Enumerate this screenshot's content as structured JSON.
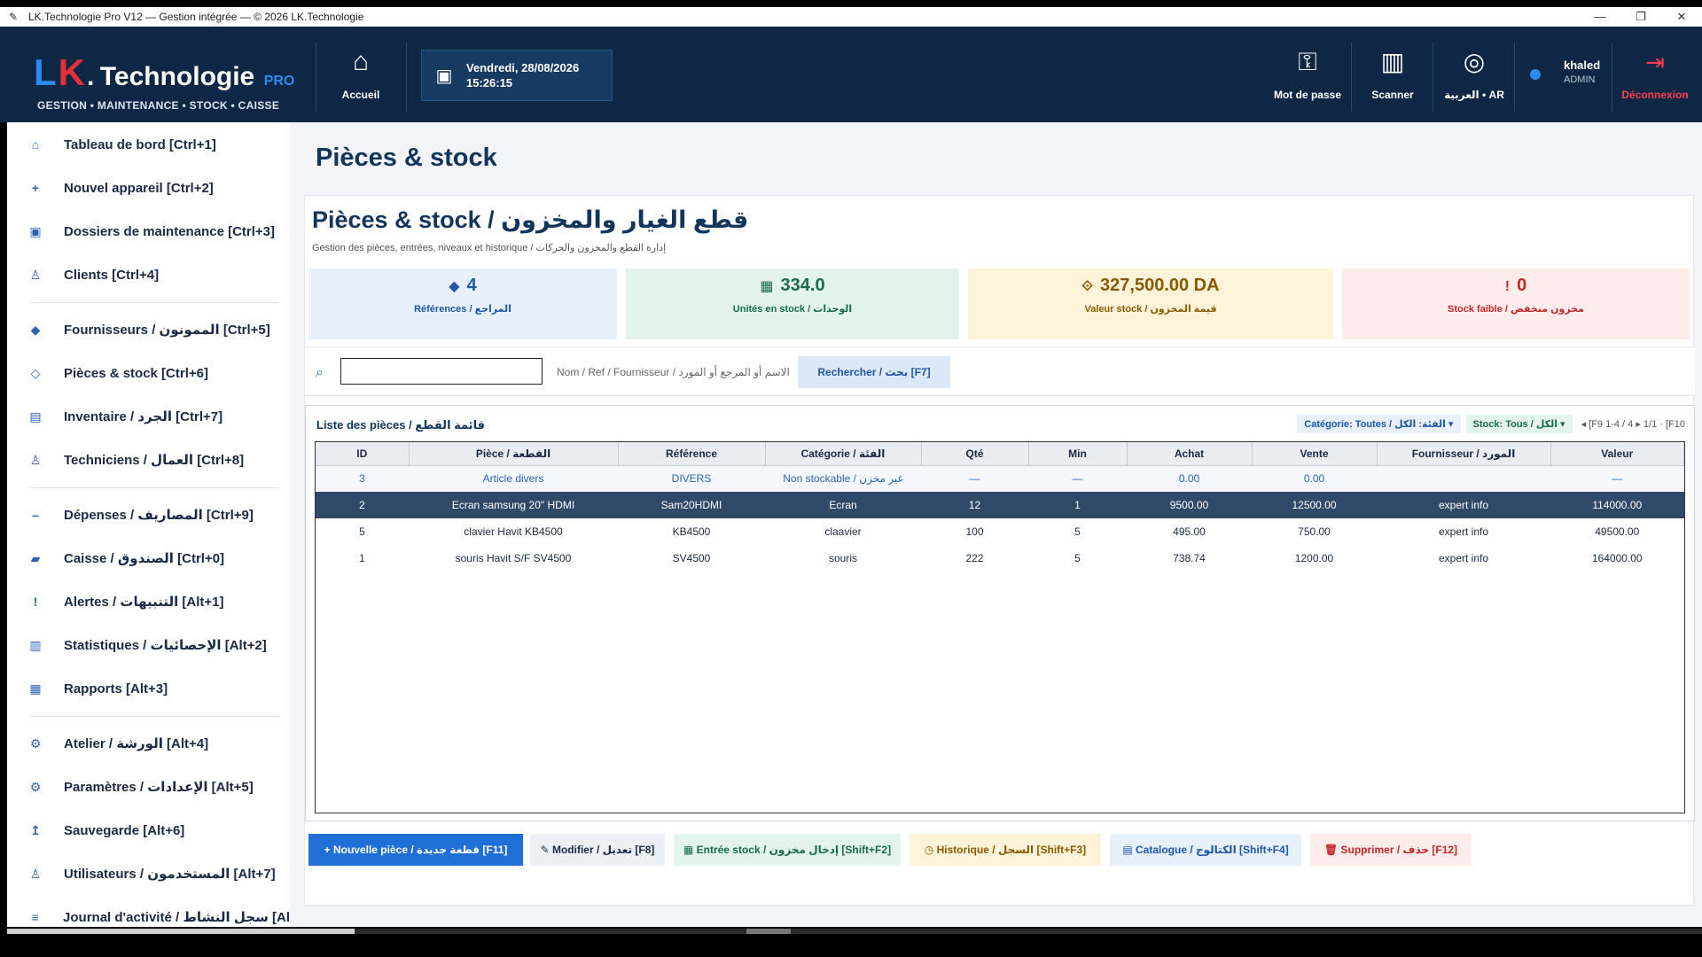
{
  "window": {
    "title": "LK.Technologie Pro V12 — Gestion intégrée — © 2026 LK.Technologie",
    "controls": [
      "—",
      "❐",
      "✕"
    ]
  },
  "header": {
    "logo_l": "L",
    "logo_k": "K",
    "logo_dot": ".",
    "logo_name": "Technologie",
    "logo_pro": "PRO",
    "logo_sub": "GESTION • MAINTENANCE • STOCK • CAISSE",
    "home_label": "Accueil",
    "date_line1": "Vendredi, 28/08/2026",
    "date_line2": "15:26:15",
    "password_label": "Mot de passe",
    "scanner_label": "Scanner",
    "lang_label": "العربية • AR",
    "user_name": "khaled",
    "user_role": "ADMIN",
    "logout_label": "Déconnexion"
  },
  "sidebar": {
    "items": [
      {
        "label": "Tableau de bord   [Ctrl+1]",
        "icon": "home-icon"
      },
      {
        "label": "Nouvel appareil   [Ctrl+2]",
        "icon": "plus-icon"
      },
      {
        "label": "Dossiers de maintenance   [Ctrl+3]",
        "icon": "folder-icon"
      },
      {
        "label": "Clients   [Ctrl+4]",
        "icon": "person-icon"
      },
      {
        "label": "Fournisseurs / الممونون   [Ctrl+5]",
        "icon": "diamond-icon"
      },
      {
        "label": "Pièces & stock   [Ctrl+6]",
        "icon": "diamond-outline-icon"
      },
      {
        "label": "Inventaire / الجرد   [Ctrl+7]",
        "icon": "list-icon"
      },
      {
        "label": "Techniciens / العمال   [Ctrl+8]",
        "icon": "person-icon"
      },
      {
        "label": "Dépenses / المصاريف   [Ctrl+9]",
        "icon": "minus-icon"
      },
      {
        "label": "Caisse / الصندوق   [Ctrl+0]",
        "icon": "cash-icon"
      },
      {
        "label": "Alertes / التنبيهات   [Alt+1]",
        "icon": "alert-icon"
      },
      {
        "label": "Statistiques / الإحصائيات   [Alt+2]",
        "icon": "chart-icon"
      },
      {
        "label": "Rapports   [Alt+3]",
        "icon": "grid-icon"
      },
      {
        "label": "Atelier / الورشة   [Alt+4]",
        "icon": "gear-icon"
      },
      {
        "label": "Paramètres / الإعدادات   [Alt+5]",
        "icon": "gear-icon"
      },
      {
        "label": "Sauvegarde   [Alt+6]",
        "icon": "save-icon"
      },
      {
        "label": "Utilisateurs / المستخدمون   [Alt+7]",
        "icon": "person-icon"
      },
      {
        "label": "Journal d'activité / سجل النشاط   [Al",
        "icon": "menu-icon"
      }
    ]
  },
  "main": {
    "page_title": "Pièces & stock",
    "card_title": "Pièces & stock / قطع الغيار والمخزون",
    "card_subtitle": "Gestion des pièces, entrées, niveaux et historique / إدارة القطع والمخزون والحركات",
    "stats": [
      {
        "value": "4",
        "label": "Références / المراجع",
        "icon": "◆"
      },
      {
        "value": "334.0",
        "label": "Unités en stock / الوحدات",
        "icon": "▦"
      },
      {
        "value": "327,500.00 DA",
        "label": "Valeur stock / قيمة المخزون",
        "icon": "⟐"
      },
      {
        "value": "0",
        "label": "Stock faible / مخزون منخفض",
        "icon": "!"
      }
    ],
    "search": {
      "value": "",
      "hint": "Nom / Ref / Fournisseur / الاسم أو المرجع أو المورد",
      "button_label": "Rechercher / بحث   [F7]"
    },
    "list": {
      "title": "Liste des pièces / قائمة القطع",
      "category_filter": "Catégorie: Toutes / الفئة: الكل ▾",
      "stock_filter": "Stock: Tous / الكل ▾",
      "pager": "◂  [F9   1-4 / 4  ▸  1/1  ·  [F10"
    },
    "table": {
      "headers": [
        "ID",
        "Pièce / القطعة",
        "Référence",
        "Catégorie / الفئة",
        "Qté",
        "Min",
        "Achat",
        "Vente",
        "Fournisseur / المورد",
        "Valeur"
      ],
      "rows": [
        [
          "3",
          "Article divers",
          "DIVERS",
          "Non stockable / غير مخزن",
          "—",
          "—",
          "0.00",
          "0.00",
          "",
          "—"
        ],
        [
          "2",
          "Ecran samsung 20\" HDMI",
          "Sam20HDMI",
          "Ecran",
          "12",
          "1",
          "9500.00",
          "12500.00",
          "expert info",
          "114000.00"
        ],
        [
          "5",
          "clavier Havit KB4500",
          "KB4500",
          "claavier",
          "100",
          "5",
          "495.00",
          "750.00",
          "expert info",
          "49500.00"
        ],
        [
          "1",
          "souris Havit S/F SV4500",
          "SV4500",
          "souris",
          "222",
          "5",
          "738.74",
          "1200.00",
          "expert info",
          "164000.00"
        ]
      ]
    },
    "actions": {
      "new": "+ Nouvelle pièce / قطعة جديدة   [F11]",
      "edit": "✎ Modifier / تعديل   [F8]",
      "stock_in": "▦ Entrée stock / إدخال مخزون   [Shift+F2]",
      "history": "◷ Historique / السجل   [Shift+F3]",
      "catalog": "▤ Catalogue / الكتالوج   [Shift+F4]",
      "delete": "🗑 Supprimer / حذف   [F12]"
    }
  },
  "colors": {
    "header_bg": "#0e2745",
    "accent": "#1f6fd6",
    "selected_row": "#2f4a68",
    "danger": "#ff3e4d"
  }
}
